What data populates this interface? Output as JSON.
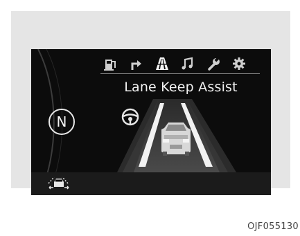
{
  "screen": {
    "tabs": [
      {
        "icon": "fuel-pump-icon",
        "active": false
      },
      {
        "icon": "turn-arrow-icon",
        "active": false
      },
      {
        "icon": "lane-icon",
        "active": true
      },
      {
        "icon": "music-note-icon",
        "active": false
      },
      {
        "icon": "wrench-icon",
        "active": false
      },
      {
        "icon": "gear-icon",
        "active": false
      }
    ],
    "title": "Lane Keep Assist",
    "gear_indicator": "N"
  },
  "caption": "OJF055130",
  "colors": {
    "panel": "#e5e5e5",
    "screen_bg": "#0c0c0c",
    "text": "#f2f2f2"
  }
}
